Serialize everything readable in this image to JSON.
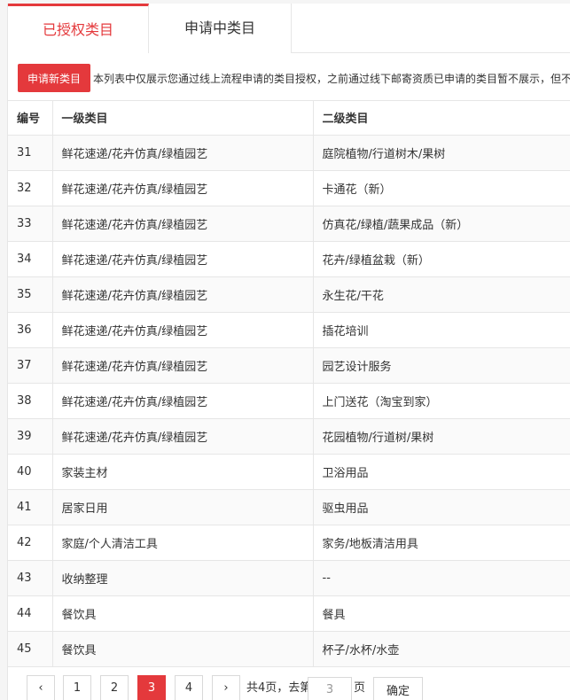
{
  "tabs": [
    {
      "label": "已授权类目"
    },
    {
      "label": "申请中类目"
    }
  ],
  "notice": {
    "button_label": "申请新类目",
    "text": "本列表中仅展示您通过线上流程申请的类目授权，之前通过线下邮寄资质已申请的类目暂不展示，但不"
  },
  "table": {
    "headers": {
      "num": "编号",
      "level1": "一级类目",
      "level2": "二级类目"
    },
    "rows": [
      {
        "num": "31",
        "level1": "鲜花速递/花卉仿真/绿植园艺",
        "level2": "庭院植物/行道树木/果树"
      },
      {
        "num": "32",
        "level1": "鲜花速递/花卉仿真/绿植园艺",
        "level2": "卡通花（新）"
      },
      {
        "num": "33",
        "level1": "鲜花速递/花卉仿真/绿植园艺",
        "level2": "仿真花/绿植/蔬果成品（新）"
      },
      {
        "num": "34",
        "level1": "鲜花速递/花卉仿真/绿植园艺",
        "level2": "花卉/绿植盆栽（新）"
      },
      {
        "num": "35",
        "level1": "鲜花速递/花卉仿真/绿植园艺",
        "level2": "永生花/干花"
      },
      {
        "num": "36",
        "level1": "鲜花速递/花卉仿真/绿植园艺",
        "level2": "插花培训"
      },
      {
        "num": "37",
        "level1": "鲜花速递/花卉仿真/绿植园艺",
        "level2": "园艺设计服务"
      },
      {
        "num": "38",
        "level1": "鲜花速递/花卉仿真/绿植园艺",
        "level2": "上门送花（淘宝到家）"
      },
      {
        "num": "39",
        "level1": "鲜花速递/花卉仿真/绿植园艺",
        "level2": "花园植物/行道树/果树"
      },
      {
        "num": "40",
        "level1": "家装主材",
        "level2": "卫浴用品"
      },
      {
        "num": "41",
        "level1": "居家日用",
        "level2": "驱虫用品"
      },
      {
        "num": "42",
        "level1": "家庭/个人清洁工具",
        "level2": "家务/地板清洁用具"
      },
      {
        "num": "43",
        "level1": "收纳整理",
        "level2": "--"
      },
      {
        "num": "44",
        "level1": "餐饮具",
        "level2": "餐具"
      },
      {
        "num": "45",
        "level1": "餐饮具",
        "level2": "杯子/水杯/水壶"
      }
    ]
  },
  "pagination": {
    "prev": "‹",
    "next": "›",
    "pages": [
      "1",
      "2",
      "3",
      "4"
    ],
    "current": "3",
    "total_text": "共4页，去第",
    "goto_value": "3",
    "page_suffix": "页",
    "confirm_label": "确定"
  }
}
